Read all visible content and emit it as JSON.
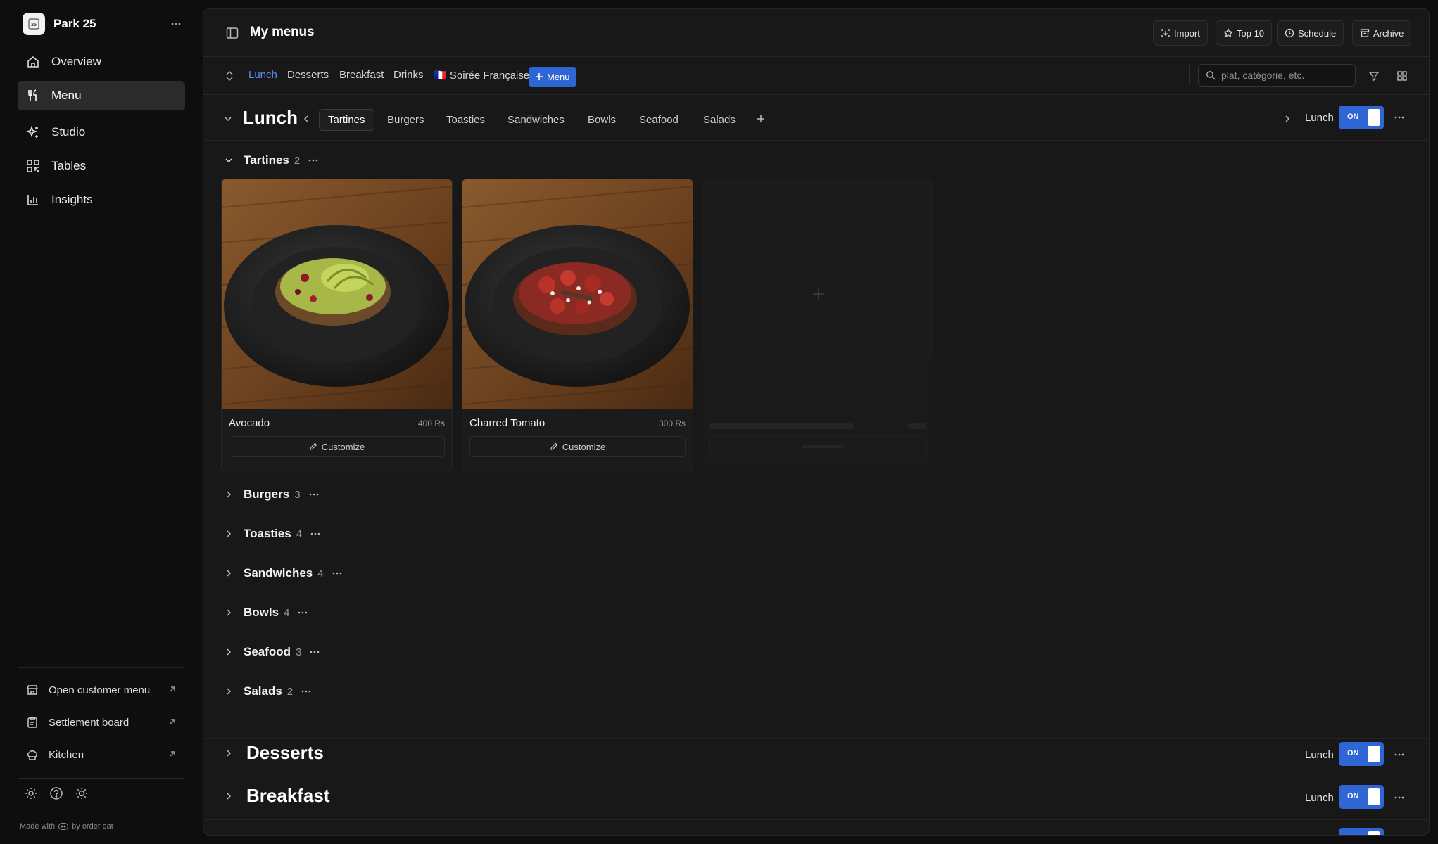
{
  "sidebar": {
    "restaurant": "Park 25",
    "nav": [
      {
        "label": "Overview",
        "icon": "home-icon"
      },
      {
        "label": "Menu",
        "icon": "utensils-icon",
        "active": true
      },
      {
        "label": "Studio",
        "icon": "sparkle-icon"
      },
      {
        "label": "Tables",
        "icon": "qr-icon"
      },
      {
        "label": "Insights",
        "icon": "chart-icon"
      }
    ],
    "links": [
      {
        "label": "Open customer menu",
        "icon": "store-icon"
      },
      {
        "label": "Settlement board",
        "icon": "clipboard-icon"
      },
      {
        "label": "Kitchen",
        "icon": "chef-hat-icon"
      }
    ],
    "footer_icons": [
      "settings-icon",
      "help-icon",
      "theme-icon"
    ],
    "made_with": "Made with",
    "by": "by order eat"
  },
  "header": {
    "title": "My menus",
    "buttons": [
      {
        "label": "Import",
        "icon": "import-icon"
      },
      {
        "label": "Top 10",
        "icon": "star-icon"
      },
      {
        "label": "Schedule",
        "icon": "clock-icon"
      },
      {
        "label": "Archive",
        "icon": "archive-icon"
      }
    ]
  },
  "menus": {
    "tabs": [
      {
        "label": "Lunch",
        "active": true
      },
      {
        "label": "Desserts"
      },
      {
        "label": "Breakfast"
      },
      {
        "label": "Drinks"
      },
      {
        "label": "🇫🇷 Soirée Française"
      }
    ],
    "new_button": "Menu",
    "search_placeholder": "plat, catégorie, etc."
  },
  "section": {
    "title": "Lunch",
    "category_tabs": [
      "Tartines",
      "Burgers",
      "Toasties",
      "Sandwiches",
      "Bowls",
      "Seafood",
      "Salads"
    ],
    "active_tab": "Tartines",
    "schedule_label": "Lunch",
    "toggle": "ON"
  },
  "categories": [
    {
      "name": "Tartines",
      "count": "2",
      "expanded": true
    },
    {
      "name": "Burgers",
      "count": "3"
    },
    {
      "name": "Toasties",
      "count": "4"
    },
    {
      "name": "Sandwiches",
      "count": "4"
    },
    {
      "name": "Bowls",
      "count": "4"
    },
    {
      "name": "Seafood",
      "count": "3"
    },
    {
      "name": "Salads",
      "count": "2"
    }
  ],
  "items": [
    {
      "name": "Avocado",
      "price": "400 Rs",
      "action": "Customize"
    },
    {
      "name": "Charred Tomato",
      "price": "300 Rs",
      "action": "Customize"
    }
  ],
  "other_sections": [
    {
      "title": "Desserts",
      "schedule_label": "Lunch",
      "toggle": "ON"
    },
    {
      "title": "Breakfast",
      "schedule_label": "Lunch",
      "toggle": "ON"
    }
  ],
  "colors": {
    "accent": "#2f66d6",
    "active_tab_text": "#5b8dff",
    "background": "#181818",
    "sidebar": "#0e0e0e"
  }
}
